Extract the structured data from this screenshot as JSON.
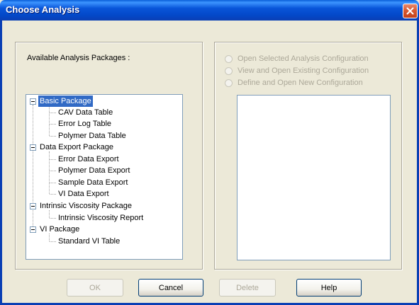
{
  "window": {
    "title": "Choose Analysis"
  },
  "left_panel": {
    "label": "Available Analysis Packages :",
    "tree": [
      {
        "label": "Basic Package",
        "expanded": true,
        "selected": true,
        "children": [
          "CAV Data Table",
          "Error Log Table",
          "Polymer Data Table"
        ]
      },
      {
        "label": "Data Export Package",
        "expanded": true,
        "selected": false,
        "children": [
          "Error Data Export",
          "Polymer Data Export",
          "Sample Data Export",
          "VI Data Export"
        ]
      },
      {
        "label": "Intrinsic Viscosity Package",
        "expanded": true,
        "selected": false,
        "children": [
          "Intrinsic Viscosity Report"
        ]
      },
      {
        "label": "VI Package",
        "expanded": true,
        "selected": false,
        "children": [
          "Standard VI Table"
        ]
      }
    ]
  },
  "right_panel": {
    "options": [
      {
        "label": "Open Selected Analysis Configuration",
        "enabled": false,
        "checked": false
      },
      {
        "label": "View and Open Existing Configuration",
        "enabled": false,
        "checked": false
      },
      {
        "label": "Define and Open New Configuration",
        "enabled": false,
        "checked": false
      }
    ]
  },
  "buttons": {
    "ok": {
      "label": "OK",
      "enabled": false
    },
    "cancel": {
      "label": "Cancel",
      "enabled": true
    },
    "delete": {
      "label": "Delete",
      "enabled": false
    },
    "help": {
      "label": "Help",
      "enabled": true
    }
  },
  "colors": {
    "titlebar": "#0348C8",
    "dialog_bg": "#ECE9D8",
    "selection": "#316AC5",
    "close_button": "#D85A32",
    "disabled_text": "#ACA899"
  }
}
